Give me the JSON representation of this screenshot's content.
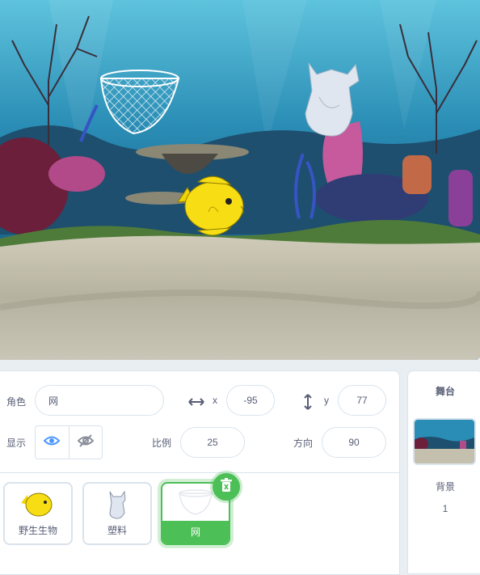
{
  "sprite_info": {
    "sprite_label": "角色",
    "sprite_name": "网",
    "x_label": "x",
    "x_value": "-95",
    "y_label": "y",
    "y_value": "77",
    "show_label": "显示",
    "size_label": "比例",
    "size_value": "25",
    "direction_label": "方向",
    "direction_value": "90"
  },
  "sprites": [
    {
      "name": "野生生物",
      "icon": "yellow-fish-icon"
    },
    {
      "name": "塑料",
      "icon": "plastic-bag-icon"
    },
    {
      "name": "网",
      "icon": "net-icon",
      "selected": true
    }
  ],
  "stage_pane": {
    "title": "舞台",
    "backdrop_label": "背景",
    "backdrop_count": "1"
  },
  "colors": {
    "accent_green": "#4cbf56",
    "visible_blue": "#4c97ff",
    "text": "#575e75"
  }
}
